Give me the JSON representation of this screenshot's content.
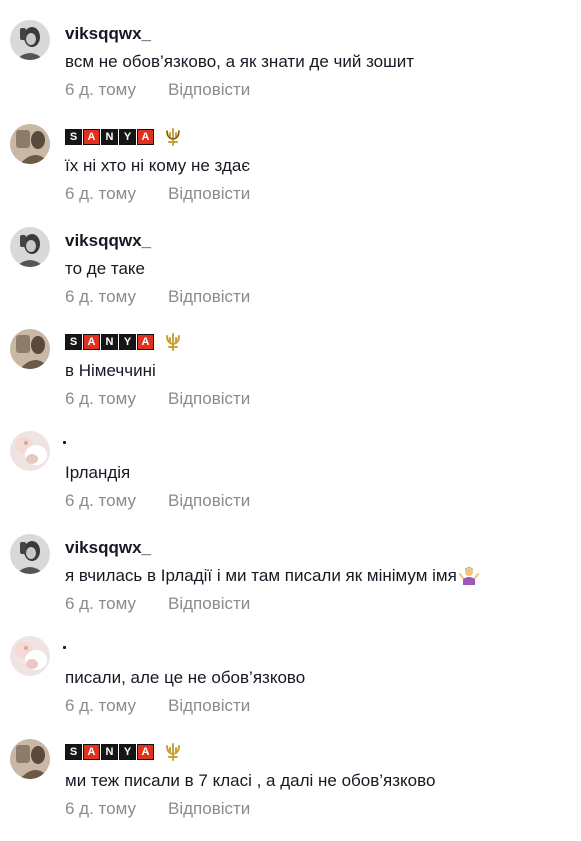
{
  "comments": [
    {
      "user": "viksqqwx_",
      "user_style": "text",
      "avatar": "avatar-gray-girl",
      "text": "всм не обов’язково, а як знати де чий зошит",
      "time": "6 д. тому",
      "reply": "Відповісти"
    },
    {
      "user": "SANYA",
      "user_style": "tiles",
      "avatar": "avatar-beige-boy",
      "text": "їх ні хто ні кому не здає",
      "time": "6 д. тому",
      "reply": "Відповісти"
    },
    {
      "user": "viksqqwx_",
      "user_style": "text",
      "avatar": "avatar-gray-girl",
      "text": "то де таке",
      "time": "6 д. тому",
      "reply": "Відповісти"
    },
    {
      "user": "SANYA",
      "user_style": "tiles",
      "avatar": "avatar-beige-boy",
      "text": "в Німеччині",
      "time": "6 д. тому",
      "reply": "Відповісти"
    },
    {
      "user": ".",
      "user_style": "dot",
      "avatar": "avatar-pink-cat",
      "text": "Ірландія",
      "time": "6 д. тому",
      "reply": "Відповісти"
    },
    {
      "user": "viksqqwx_",
      "user_style": "text",
      "avatar": "avatar-gray-girl",
      "text": "я вчилась в Ірладії і ми там писали як мінімум імя",
      "emoji": "person-shrugging-emoji",
      "time": "6 д. тому",
      "reply": "Відповісти"
    },
    {
      "user": ".",
      "user_style": "dot",
      "avatar": "avatar-pink-cat",
      "text": "писали, але це не обов’язково",
      "time": "6 д. тому",
      "reply": "Відповісти"
    },
    {
      "user": "SANYA",
      "user_style": "tiles",
      "avatar": "avatar-beige-boy",
      "text": "ми теж писали в 7 класі , а далі не обов’язково",
      "time": "6 д. тому",
      "reply": "Відповісти"
    }
  ],
  "sanya_letters": [
    "S",
    "A",
    "N",
    "Y",
    "A"
  ],
  "colors": {
    "text": "#161823",
    "muted": "#8a8b91",
    "tile_dark": "#161616",
    "tile_red": "#e0301e",
    "trident": "#c9a23a"
  }
}
